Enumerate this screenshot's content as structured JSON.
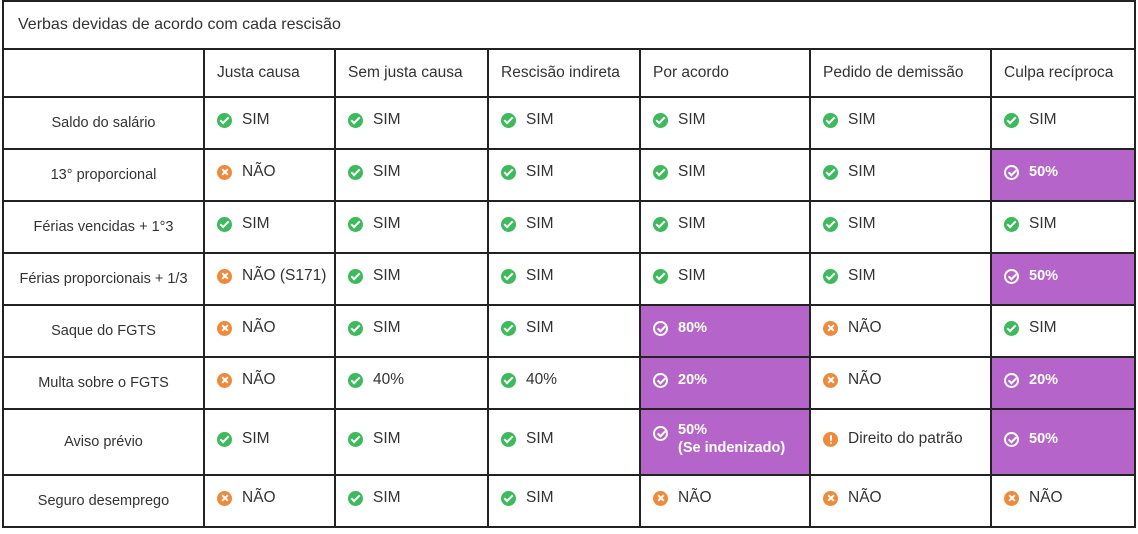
{
  "table": {
    "title": "Verbas devidas de acordo com cada rescisão",
    "columns": [
      "Justa causa",
      "Sem justa causa",
      "Rescisão indireta",
      "Por acordo",
      "Pedido de demissão",
      "Culpa recíproca"
    ],
    "rows": [
      {
        "label": "Saldo do salário",
        "cells": [
          {
            "icon": "check-icon",
            "text": "SIM"
          },
          {
            "icon": "check-icon",
            "text": "SIM"
          },
          {
            "icon": "check-icon",
            "text": "SIM"
          },
          {
            "icon": "check-icon",
            "text": "SIM"
          },
          {
            "icon": "check-icon",
            "text": "SIM"
          },
          {
            "icon": "check-icon",
            "text": "SIM"
          }
        ]
      },
      {
        "label": "13° proporcional",
        "cells": [
          {
            "icon": "x-icon",
            "text": "NÃO"
          },
          {
            "icon": "check-icon",
            "text": "SIM"
          },
          {
            "icon": "check-icon",
            "text": "SIM"
          },
          {
            "icon": "check-icon",
            "text": "SIM"
          },
          {
            "icon": "check-icon",
            "text": "SIM"
          },
          {
            "icon": "outline-check-icon",
            "text": "50%",
            "highlight": true
          }
        ]
      },
      {
        "label": "Férias vencidas + 1°3",
        "cells": [
          {
            "icon": "check-icon",
            "text": "SIM"
          },
          {
            "icon": "check-icon",
            "text": "SIM"
          },
          {
            "icon": "check-icon",
            "text": "SIM"
          },
          {
            "icon": "check-icon",
            "text": "SIM"
          },
          {
            "icon": "check-icon",
            "text": "SIM"
          },
          {
            "icon": "check-icon",
            "text": "SIM"
          }
        ]
      },
      {
        "label": "Férias proporcionais + 1/3",
        "cells": [
          {
            "icon": "x-icon",
            "text": "NÃO (S171)"
          },
          {
            "icon": "check-icon",
            "text": "SIM"
          },
          {
            "icon": "check-icon",
            "text": "SIM"
          },
          {
            "icon": "check-icon",
            "text": "SIM"
          },
          {
            "icon": "check-icon",
            "text": "SIM"
          },
          {
            "icon": "outline-check-icon",
            "text": "50%",
            "highlight": true
          }
        ]
      },
      {
        "label": "Saque do FGTS",
        "cells": [
          {
            "icon": "x-icon",
            "text": "NÃO"
          },
          {
            "icon": "check-icon",
            "text": "SIM"
          },
          {
            "icon": "check-icon",
            "text": "SIM"
          },
          {
            "icon": "outline-check-icon",
            "text": "80%",
            "highlight": true
          },
          {
            "icon": "x-icon",
            "text": "NÃO"
          },
          {
            "icon": "check-icon",
            "text": "SIM"
          }
        ]
      },
      {
        "label": "Multa sobre o FGTS",
        "cells": [
          {
            "icon": "x-icon",
            "text": "NÃO"
          },
          {
            "icon": "check-icon",
            "text": "40%"
          },
          {
            "icon": "check-icon",
            "text": "40%"
          },
          {
            "icon": "outline-check-icon",
            "text": "20%",
            "highlight": true
          },
          {
            "icon": "x-icon",
            "text": "NÃO"
          },
          {
            "icon": "outline-check-icon",
            "text": "20%",
            "highlight": true
          }
        ]
      },
      {
        "label": "Aviso prévio",
        "cells": [
          {
            "icon": "check-icon",
            "text": "SIM"
          },
          {
            "icon": "check-icon",
            "text": "SIM"
          },
          {
            "icon": "check-icon",
            "text": "SIM"
          },
          {
            "icon": "outline-check-icon",
            "text": "50%\n(Se indenizado)",
            "highlight": true
          },
          {
            "icon": "warning-icon",
            "text": "Direito do patrão"
          },
          {
            "icon": "outline-check-icon",
            "text": "50%",
            "highlight": true
          }
        ]
      },
      {
        "label": "Seguro desemprego",
        "cells": [
          {
            "icon": "x-icon",
            "text": "NÃO"
          },
          {
            "icon": "check-icon",
            "text": "SIM"
          },
          {
            "icon": "check-icon",
            "text": "SIM"
          },
          {
            "icon": "x-icon",
            "text": "NÃO"
          },
          {
            "icon": "x-icon",
            "text": "NÃO"
          },
          {
            "icon": "x-icon",
            "text": "NÃO"
          }
        ]
      }
    ]
  },
  "colors": {
    "highlight": "#b565c9",
    "check": "#3cba5c",
    "negative": "#ef8a3d",
    "border": "#222222",
    "text": "#333333"
  }
}
